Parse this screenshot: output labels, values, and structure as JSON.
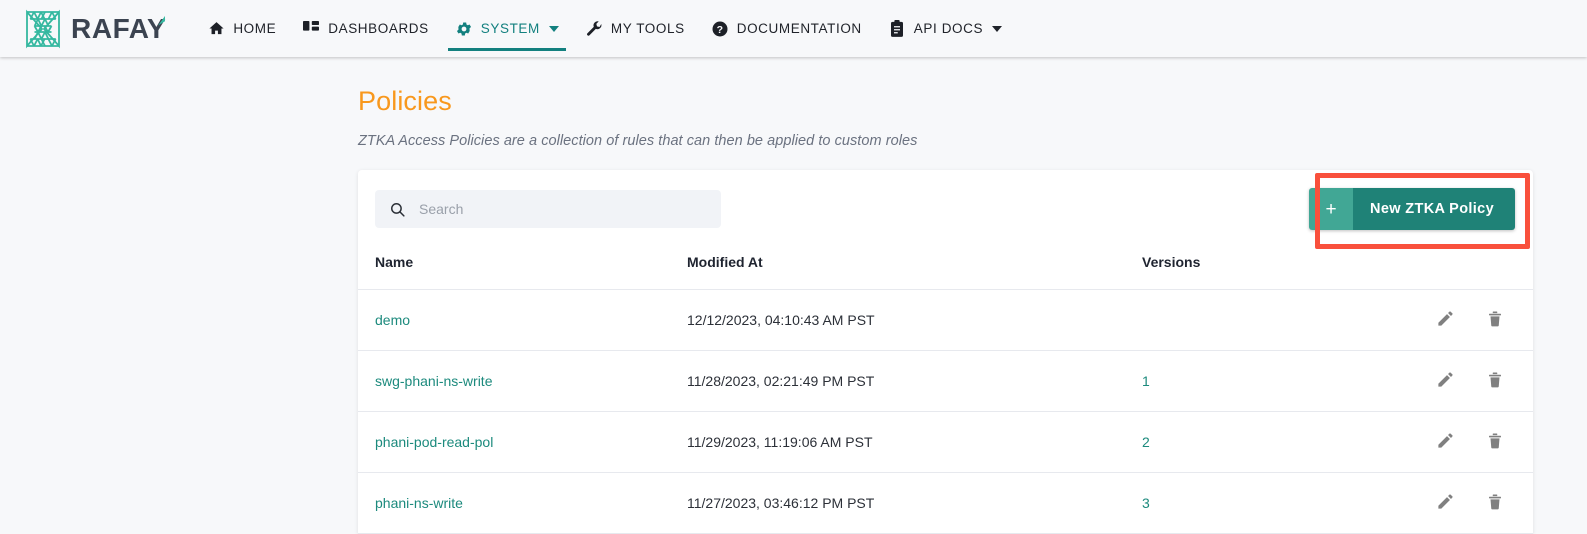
{
  "brand": {
    "name": "RAFAY",
    "logo_icon": "rafay-mesh-logo"
  },
  "nav": {
    "items": [
      {
        "label": "HOME",
        "icon": "home-icon",
        "active": false,
        "caret": false
      },
      {
        "label": "DASHBOARDS",
        "icon": "dashboards-grid-icon",
        "active": false,
        "caret": false
      },
      {
        "label": "SYSTEM",
        "icon": "gear-icon",
        "active": true,
        "caret": true
      },
      {
        "label": "MY TOOLS",
        "icon": "wrench-icon",
        "active": false,
        "caret": false
      },
      {
        "label": "DOCUMENTATION",
        "icon": "question-circle-icon",
        "active": false,
        "caret": false
      },
      {
        "label": "API DOCS",
        "icon": "clipboard-icon",
        "active": false,
        "caret": true
      }
    ]
  },
  "page": {
    "title": "Policies",
    "subtitle": "ZTKA Access Policies are a collection of rules that can then be applied to custom roles"
  },
  "toolbar": {
    "search_placeholder": "Search",
    "search_value": "",
    "search_icon": "search-icon",
    "new_policy_plus": "+",
    "new_policy_label": "New ZTKA Policy"
  },
  "table": {
    "headers": {
      "name": "Name",
      "modified_at": "Modified At",
      "versions": "Versions",
      "actions": ""
    },
    "rows": [
      {
        "name": "demo",
        "modified_at": "12/12/2023, 04:10:43 AM PST",
        "versions": "",
        "edit_icon": "pencil-icon",
        "delete_icon": "trash-icon"
      },
      {
        "name": "swg-phani-ns-write",
        "modified_at": "11/28/2023, 02:21:49 PM PST",
        "versions": "1",
        "edit_icon": "pencil-icon",
        "delete_icon": "trash-icon"
      },
      {
        "name": "phani-pod-read-pol",
        "modified_at": "11/29/2023, 11:19:06 AM PST",
        "versions": "2",
        "edit_icon": "pencil-icon",
        "delete_icon": "trash-icon"
      },
      {
        "name": "phani-ns-write",
        "modified_at": "11/27/2023, 03:46:12 PM PST",
        "versions": "3",
        "edit_icon": "pencil-icon",
        "delete_icon": "trash-icon"
      }
    ]
  },
  "colors": {
    "brand_teal": "#35b8a0",
    "accent_teal": "#1c8a7d",
    "nav_active": "#13807f",
    "title_orange": "#f8981d",
    "button_teal": "#1f8277",
    "button_teal_light": "#41a795",
    "highlight_red": "#f9503c",
    "page_background": "#f7f8fa"
  }
}
